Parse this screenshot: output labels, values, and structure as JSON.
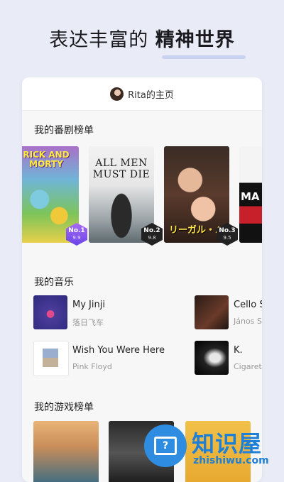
{
  "headline": {
    "normal": "表达丰富的",
    "bold": "精神世界"
  },
  "profile": {
    "title": "Rita的主页"
  },
  "drama": {
    "section_title": "我的番剧榜单",
    "posters": [
      {
        "text": "RICK AND MORTY",
        "rank": "No.1",
        "score": "9.9"
      },
      {
        "text": "ALL MEN MUST DIE",
        "rank": "No.2",
        "score": "9.8"
      },
      {
        "text": "リーガル・ハ",
        "rank": "No.3",
        "score": "9.5"
      },
      {
        "text": "MA"
      }
    ]
  },
  "music": {
    "section_title": "我的音乐",
    "items": [
      {
        "title": "My Jinji",
        "artist": "落日飞车"
      },
      {
        "title": "Wish You Were Here",
        "artist": "Pink Floyd"
      },
      {
        "title": "Cello S",
        "artist": "János S"
      },
      {
        "title": "K.",
        "artist": "Cigaret"
      }
    ]
  },
  "games": {
    "section_title": "我的游戏榜单"
  },
  "watermark": {
    "text": "知识屋",
    "url": "zhishiwu.com"
  }
}
